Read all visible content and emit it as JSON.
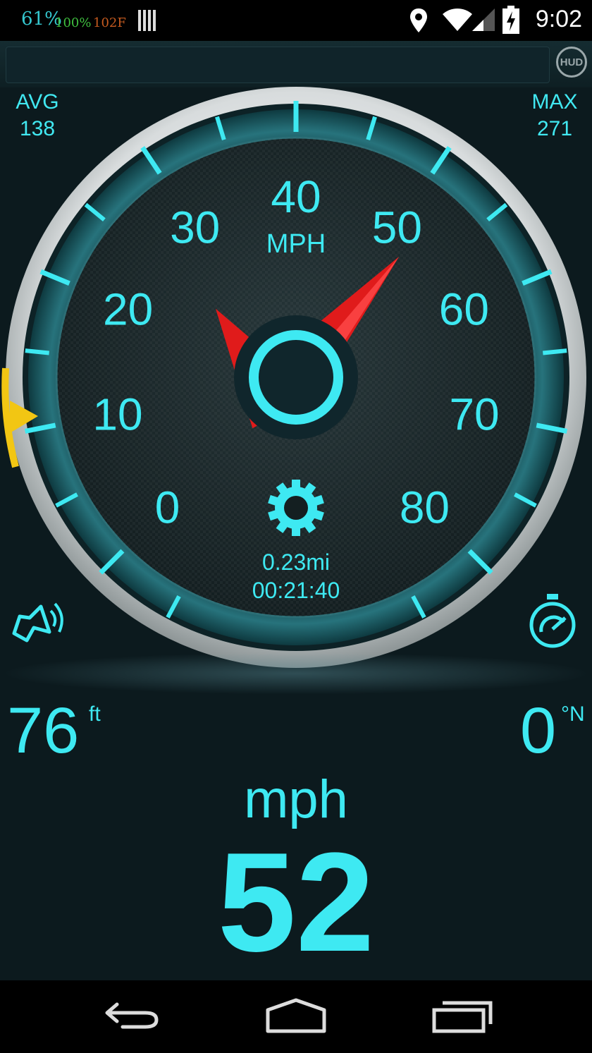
{
  "status_bar": {
    "battery_pct": "61%",
    "charge_pct": "100%",
    "temperature": "102F",
    "clock": "9:02"
  },
  "app_bar": {
    "hud_label": "HUD"
  },
  "stats": {
    "avg_label": "AVG",
    "avg_value": "138",
    "max_label": "MAX",
    "max_value": "271"
  },
  "gauge": {
    "unit": "MPH",
    "tick_labels": [
      "0",
      "10",
      "20",
      "30",
      "40",
      "50",
      "60",
      "70",
      "80"
    ],
    "needle_value": 52,
    "min": 0,
    "max": 80,
    "distance": "0.23mi",
    "trip_time": "00:21:40",
    "accent": "#3ee9f2",
    "needle_color": "#e01b1b"
  },
  "readouts": {
    "altitude_value": "76",
    "altitude_unit": "ft",
    "heading_value": "0",
    "heading_unit": "°N",
    "speed_unit": "mph",
    "speed_value": "52"
  }
}
